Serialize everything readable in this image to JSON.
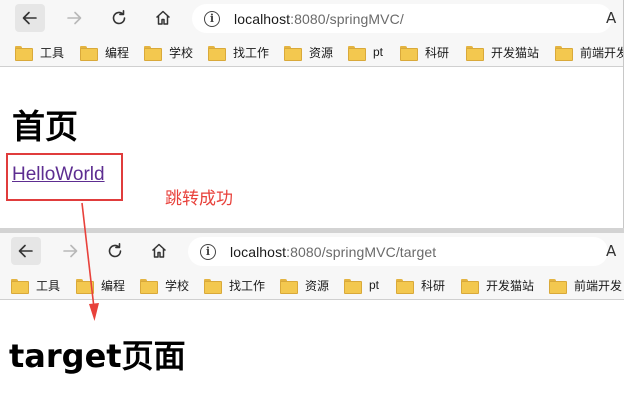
{
  "top_window": {
    "url_host": "localhost",
    "url_rest": ":8080/springMVC/",
    "heading": "首页",
    "link_text": "HelloWorld"
  },
  "bottom_window": {
    "url_host": "localhost",
    "url_rest": ":8080/springMVC/target",
    "heading": "target页面"
  },
  "bookmarks": [
    "工具",
    "编程",
    "学校",
    "找工作",
    "资源",
    "pt",
    "科研",
    "开发猫站",
    "前端开发"
  ],
  "toolbar": {
    "info_symbol": "i",
    "read_aloud": "A"
  },
  "annotation": {
    "text": "跳转成功",
    "color": "#e8413b"
  },
  "colors": {
    "visited_link": "#5d2d91",
    "highlight_border": "#e03c3c",
    "bookmark_folder": "#f3c84f"
  }
}
